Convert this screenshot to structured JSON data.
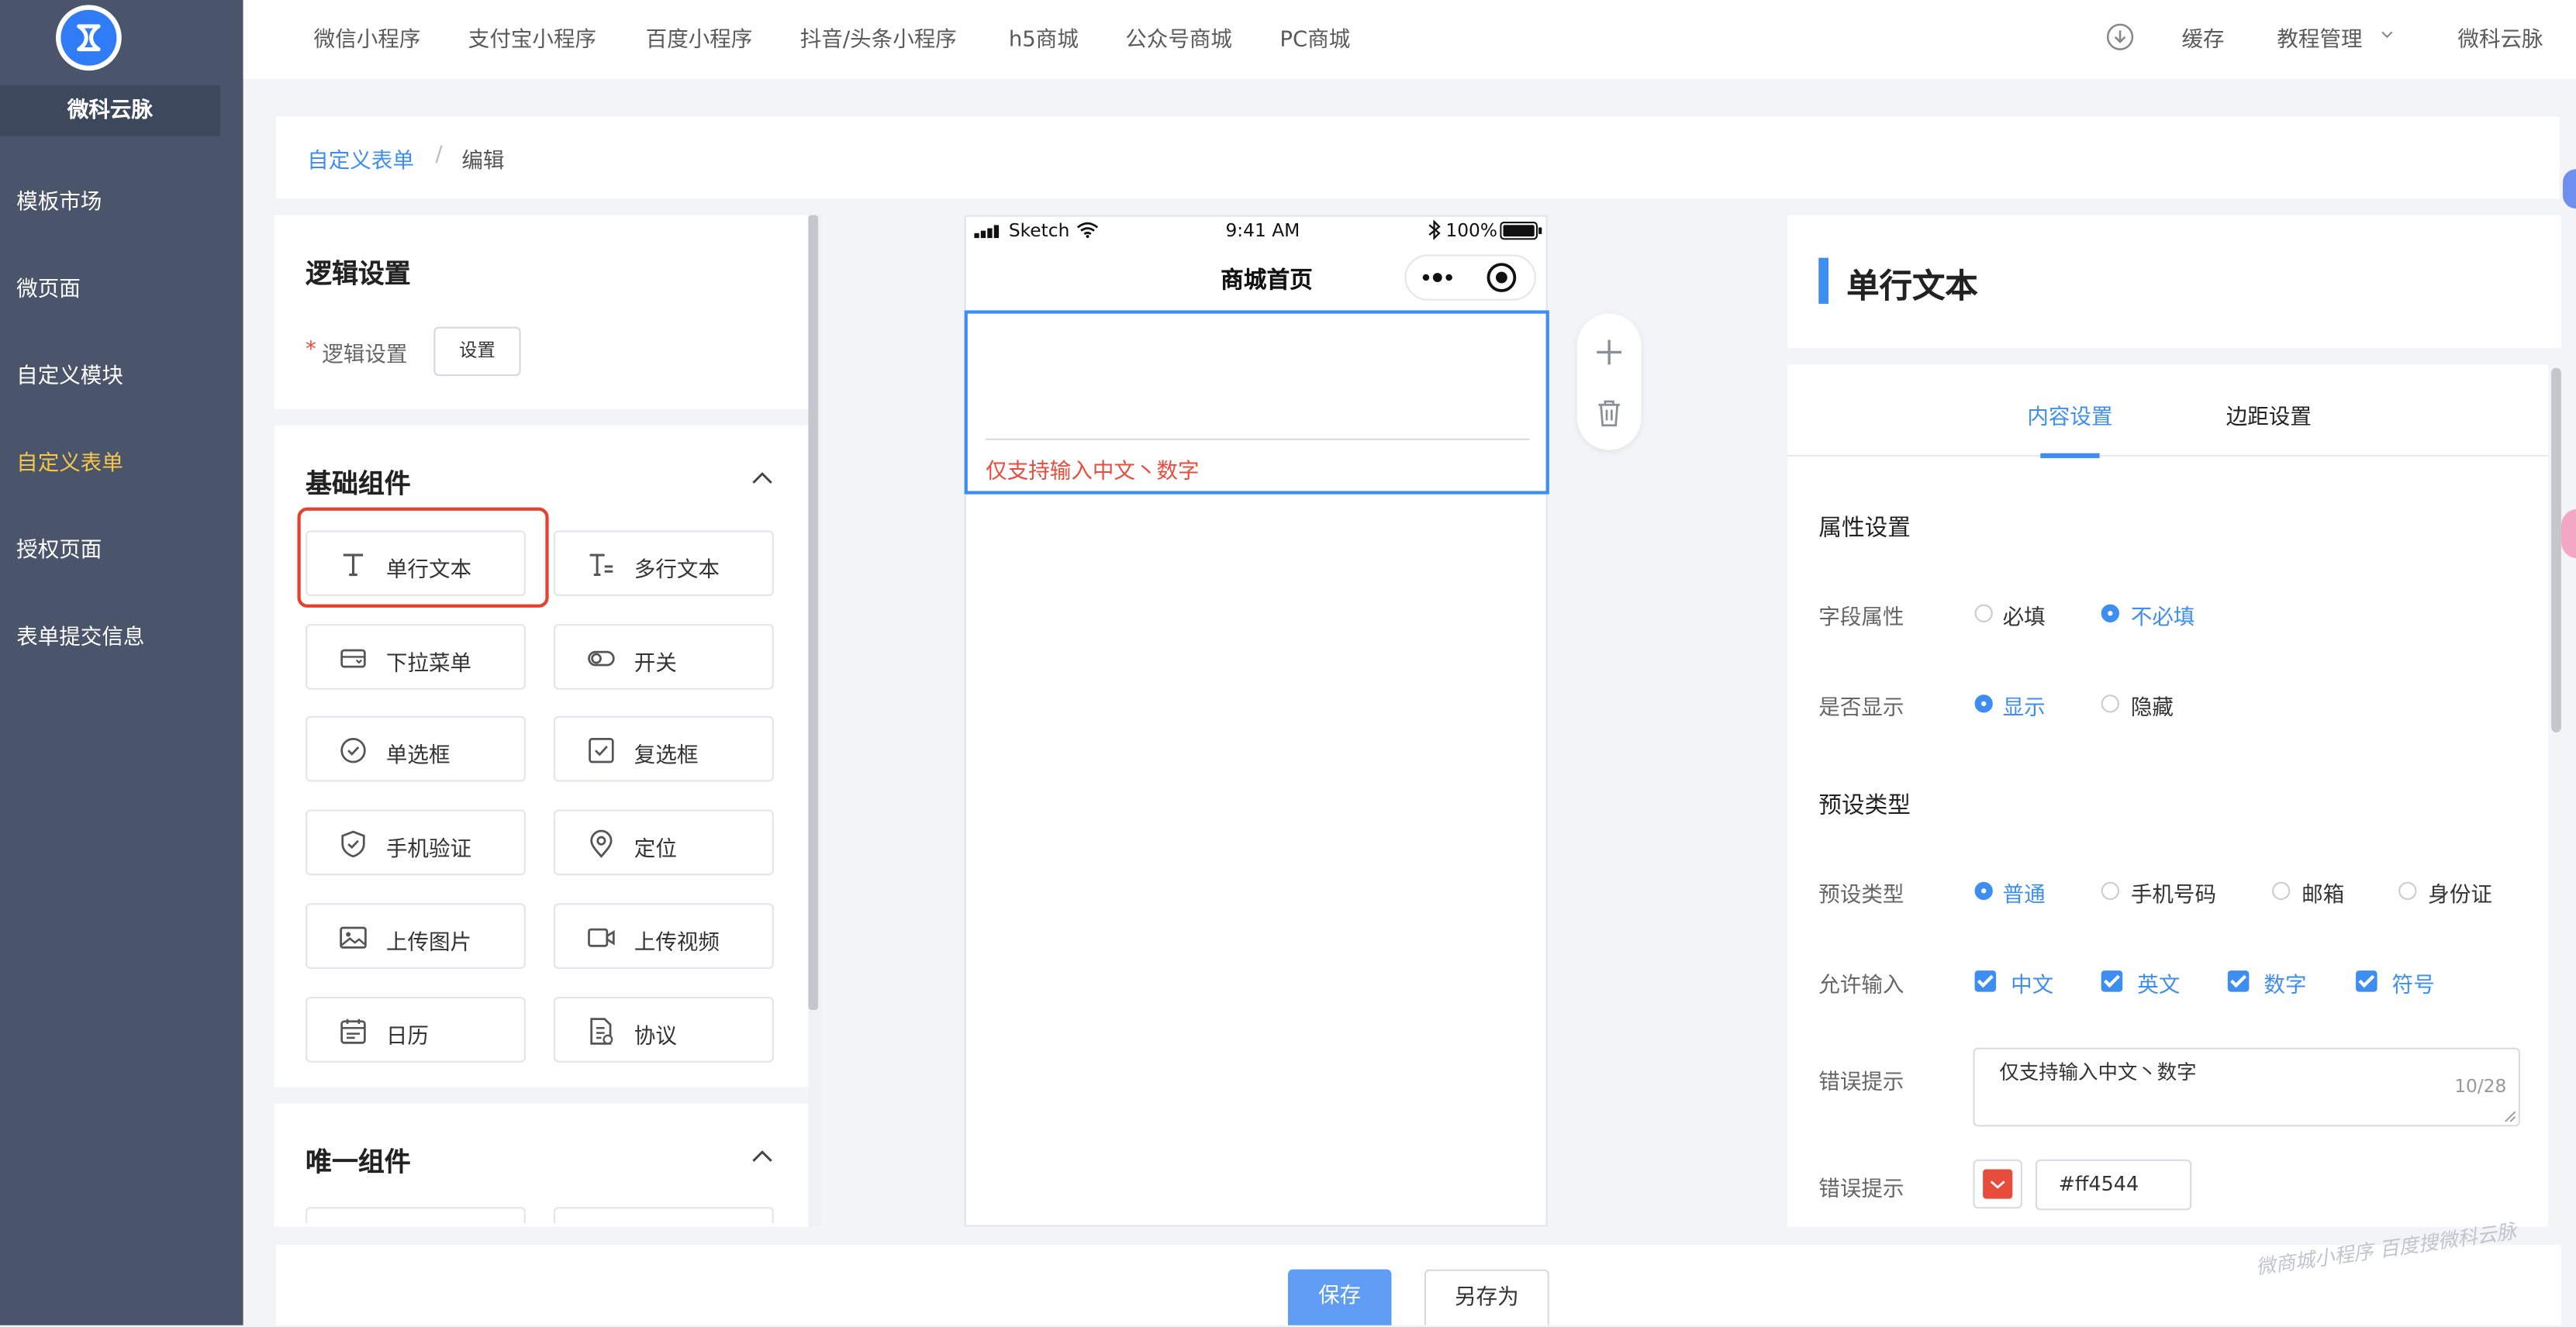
{
  "brand": {
    "name": "微科云脉"
  },
  "sidebar": {
    "items": [
      {
        "label": "模板市场",
        "active": false
      },
      {
        "label": "微页面",
        "active": false
      },
      {
        "label": "自定义模块",
        "active": false
      },
      {
        "label": "自定义表单",
        "active": true
      },
      {
        "label": "授权页面",
        "active": false
      },
      {
        "label": "表单提交信息",
        "active": false
      }
    ]
  },
  "topnav": {
    "items": [
      "微信小程序",
      "支付宝小程序",
      "百度小程序",
      "抖音/头条小程序",
      "h5商城",
      "公众号商城",
      "PC商城"
    ],
    "cache": "缓存",
    "tutorial": "教程管理",
    "user": "微科云脉"
  },
  "breadcrumb": {
    "parent": "自定义表单",
    "separator": "/",
    "current": "编辑"
  },
  "logic": {
    "title": "逻辑设置",
    "required_mark": "*",
    "label": "逻辑设置",
    "button": "设置"
  },
  "basic": {
    "title": "基础组件",
    "components": [
      {
        "label": "单行文本",
        "icon": "single-line-text-icon"
      },
      {
        "label": "多行文本",
        "icon": "multi-line-text-icon"
      },
      {
        "label": "下拉菜单",
        "icon": "dropdown-icon"
      },
      {
        "label": "开关",
        "icon": "switch-icon"
      },
      {
        "label": "单选框",
        "icon": "radio-icon"
      },
      {
        "label": "复选框",
        "icon": "checkbox-icon"
      },
      {
        "label": "手机验证",
        "icon": "shield-icon"
      },
      {
        "label": "定位",
        "icon": "location-icon"
      },
      {
        "label": "上传图片",
        "icon": "image-icon"
      },
      {
        "label": "上传视频",
        "icon": "video-icon"
      },
      {
        "label": "日历",
        "icon": "calendar-icon"
      },
      {
        "label": "协议",
        "icon": "agreement-icon"
      }
    ]
  },
  "unique": {
    "title": "唯一组件"
  },
  "phone": {
    "carrier": "Sketch",
    "time": "9:41 AM",
    "battery": "100%",
    "page_title": "商城首页",
    "error_text": "仅支持输入中文丶数字"
  },
  "right": {
    "header": "单行文本",
    "tabs": [
      "内容设置",
      "边距设置"
    ],
    "active_tab": 0,
    "attr_title": "属性设置",
    "field_attr": {
      "label": "字段属性",
      "options": [
        "必填",
        "不必填"
      ],
      "selected": 1
    },
    "display": {
      "label": "是否显示",
      "options": [
        "显示",
        "隐藏"
      ],
      "selected": 0
    },
    "preset_title": "预设类型",
    "preset": {
      "label": "预设类型",
      "options": [
        "普通",
        "手机号码",
        "邮箱",
        "身份证"
      ],
      "selected": 0
    },
    "allow": {
      "label": "允许输入",
      "options": [
        "中文",
        "英文",
        "数字",
        "符号"
      ],
      "checked": [
        true,
        true,
        true,
        true
      ]
    },
    "error_tip": {
      "label": "错误提示",
      "value": "仅支持输入中文丶数字",
      "count": "10/28"
    },
    "error_color": {
      "label": "错误提示",
      "value": "#ff4544"
    }
  },
  "footer": {
    "save": "保存",
    "save_as": "另存为"
  },
  "watermark": "微商城小程序 百度搜微科云脉",
  "colors": {
    "accent": "#3d8ef0",
    "sidebar": "#4a556b",
    "active_menu": "#f6c64a",
    "error": "#e84c3d",
    "highlight_border": "#e8402e"
  }
}
